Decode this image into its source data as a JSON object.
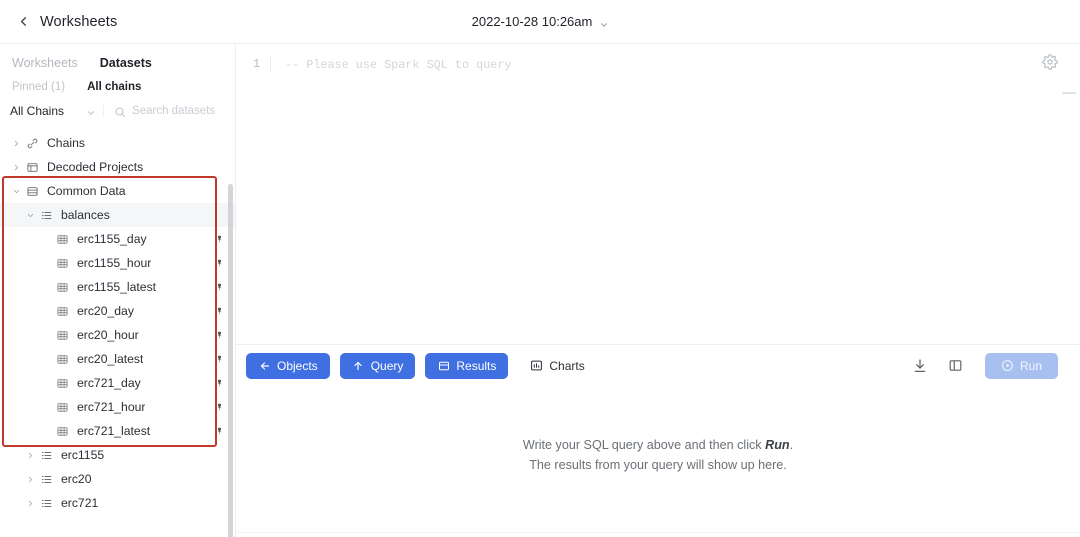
{
  "topbar": {
    "back_icon": "chevron-left-icon",
    "title": "Worksheets",
    "date": "2022-10-28 10:26am",
    "date_caret_icon": "chevron-down-icon"
  },
  "sidebar": {
    "tabs": [
      {
        "label": "Worksheets",
        "active": false
      },
      {
        "label": "Datasets",
        "active": true
      }
    ],
    "subtabs": [
      {
        "label": "Pinned (1)",
        "active": false
      },
      {
        "label": "All chains",
        "active": true
      }
    ],
    "filter": {
      "chain_label": "All Chains",
      "chain_caret_icon": "chevron-down-icon",
      "search_icon": "search-icon",
      "search_value": "",
      "search_placeholder": "Search datasets"
    },
    "tree": [
      {
        "label": "Chains",
        "icon": "chain-node-icon",
        "depth": 0,
        "twisty": "collapsed",
        "pin": false,
        "highlight": false
      },
      {
        "label": "Decoded Projects",
        "icon": "decoded-projects-icon",
        "depth": 0,
        "twisty": "collapsed",
        "pin": false,
        "highlight": false
      },
      {
        "label": "Common Data",
        "icon": "common-data-icon",
        "depth": 0,
        "twisty": "expanded",
        "pin": false,
        "highlight": false
      },
      {
        "label": "balances",
        "icon": "dataset-group-icon",
        "depth": 1,
        "twisty": "expanded",
        "pin": false,
        "highlight": true
      },
      {
        "label": "erc1155_day",
        "icon": "table-icon",
        "depth": 2,
        "twisty": "none",
        "pin": true,
        "highlight": false
      },
      {
        "label": "erc1155_hour",
        "icon": "table-icon",
        "depth": 2,
        "twisty": "none",
        "pin": true,
        "highlight": false
      },
      {
        "label": "erc1155_latest",
        "icon": "table-icon",
        "depth": 2,
        "twisty": "none",
        "pin": true,
        "highlight": false
      },
      {
        "label": "erc20_day",
        "icon": "table-icon",
        "depth": 2,
        "twisty": "none",
        "pin": true,
        "highlight": false
      },
      {
        "label": "erc20_hour",
        "icon": "table-icon",
        "depth": 2,
        "twisty": "none",
        "pin": true,
        "highlight": false
      },
      {
        "label": "erc20_latest",
        "icon": "table-icon",
        "depth": 2,
        "twisty": "none",
        "pin": true,
        "highlight": false
      },
      {
        "label": "erc721_day",
        "icon": "table-icon",
        "depth": 2,
        "twisty": "none",
        "pin": true,
        "highlight": false
      },
      {
        "label": "erc721_hour",
        "icon": "table-icon",
        "depth": 2,
        "twisty": "none",
        "pin": true,
        "highlight": false
      },
      {
        "label": "erc721_latest",
        "icon": "table-icon",
        "depth": 2,
        "twisty": "none",
        "pin": true,
        "highlight": false
      },
      {
        "label": "erc1155",
        "icon": "dataset-group-icon",
        "depth": 1,
        "twisty": "collapsed",
        "pin": false,
        "highlight": false
      },
      {
        "label": "erc20",
        "icon": "dataset-group-icon",
        "depth": 1,
        "twisty": "collapsed",
        "pin": false,
        "highlight": false
      },
      {
        "label": "erc721",
        "icon": "dataset-group-icon",
        "depth": 1,
        "twisty": "collapsed",
        "pin": false,
        "highlight": false
      }
    ],
    "annotation_color": "#c0392b"
  },
  "editor": {
    "line_number": "1",
    "placeholder_code": "-- Please use Spark SQL to query",
    "gear_icon": "gear-icon",
    "collapse_icon": "collapse-handle-icon"
  },
  "toolbar": {
    "buttons": [
      {
        "label": "Objects",
        "icon": "arrow-left-icon",
        "style": "primary"
      },
      {
        "label": "Query",
        "icon": "arrow-up-icon",
        "style": "primary"
      },
      {
        "label": "Results",
        "icon": "results-panel-icon",
        "style": "primary"
      },
      {
        "label": "Charts",
        "icon": "chart-icon",
        "style": "ghost"
      }
    ],
    "download_icon": "download-icon",
    "layout_icon": "split-panel-icon",
    "run_label": "Run",
    "run_icon": "play-circle-icon",
    "primary_color": "#3f6fe0",
    "run_disabled_color": "#a8c0f0"
  },
  "results": {
    "line1_prefix": "Write your SQL query above and then click ",
    "line1_emphasis": "Run",
    "line1_suffix": ".",
    "line2": "The results from your query will show up here."
  }
}
